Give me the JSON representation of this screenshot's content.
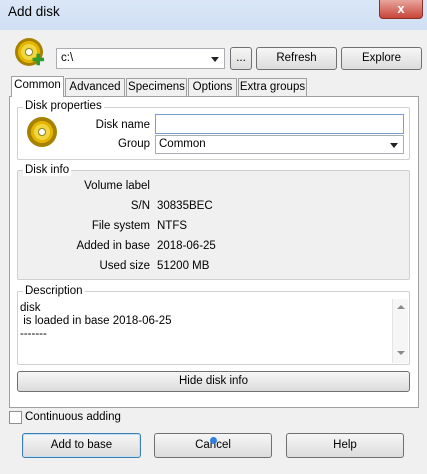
{
  "window": {
    "title": "Add disk",
    "close_glyph": "x"
  },
  "toolbar": {
    "path_value": "c:\\",
    "browse_label": "...",
    "refresh_label": "Refresh",
    "explore_label": "Explore",
    "icon": "cd-add-icon"
  },
  "tabs": [
    {
      "label": "Common",
      "active": true
    },
    {
      "label": "Advanced",
      "active": false
    },
    {
      "label": "Specimens",
      "active": false
    },
    {
      "label": "Options",
      "active": false
    },
    {
      "label": "Extra groups",
      "active": false
    }
  ],
  "disk_properties": {
    "title": "Disk properties",
    "name_label": "Disk name",
    "name_value": "",
    "group_label": "Group",
    "group_value": "Common",
    "icon": "cd-icon"
  },
  "disk_info": {
    "title": "Disk info",
    "rows": [
      {
        "label": "Volume label",
        "value": ""
      },
      {
        "label": "S/N",
        "value": "30835BEC"
      },
      {
        "label": "File system",
        "value": "NTFS"
      },
      {
        "label": "Added in base",
        "value": "2018-06-25"
      },
      {
        "label": "Used size",
        "value": "51200 MB"
      }
    ]
  },
  "description": {
    "title": "Description",
    "lines": [
      "disk",
      " is loaded in base 2018-06-25",
      "-------"
    ]
  },
  "hide_info_label": "Hide disk info",
  "continuous_adding": {
    "label": "Continuous adding",
    "checked": false
  },
  "footer": {
    "add_label": "Add to base",
    "cancel_label": "Cancel",
    "help_label": "Help"
  }
}
